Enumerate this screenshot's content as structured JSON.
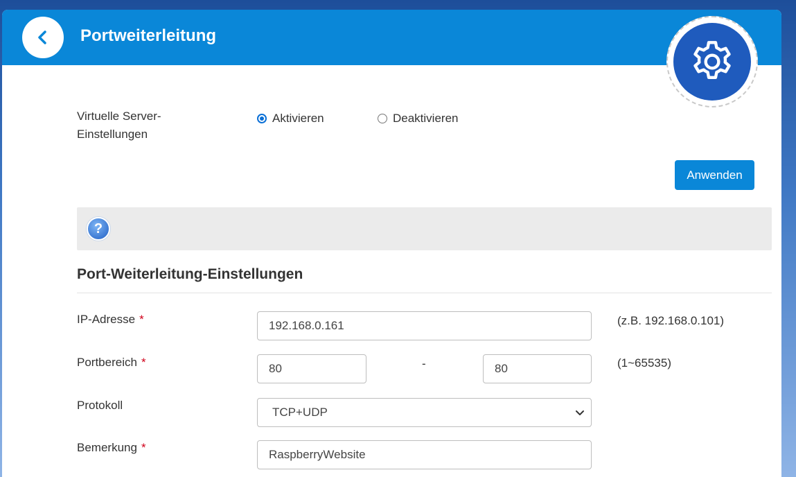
{
  "header": {
    "title": "Portweiterleitung"
  },
  "virtual_server": {
    "label_line1": "Virtuelle Server-",
    "label_line2": "Einstellungen",
    "options": [
      {
        "label": "Aktivieren",
        "checked": true
      },
      {
        "label": "Deaktivieren",
        "checked": false
      }
    ],
    "apply_label": "Anwenden"
  },
  "help": {
    "icon_text": "?"
  },
  "section": {
    "title": "Port-Weiterleitung-Einstellungen"
  },
  "form": {
    "required_mark": "*",
    "ip": {
      "label": "IP-Adresse",
      "value": "192.168.0.161",
      "hint": "(z.B. 192.168.0.101)"
    },
    "port": {
      "label": "Portbereich",
      "from": "80",
      "separator": "-",
      "to": "80",
      "hint": "(1~65535)"
    },
    "protocol": {
      "label": "Protokoll",
      "value": "TCP+UDP"
    },
    "remark": {
      "label": "Bemerkung",
      "value": "RaspberryWebsite"
    }
  },
  "colors": {
    "header": "#0a87d8",
    "gear_circle": "#1f5bbd",
    "required": "#d0021b"
  }
}
